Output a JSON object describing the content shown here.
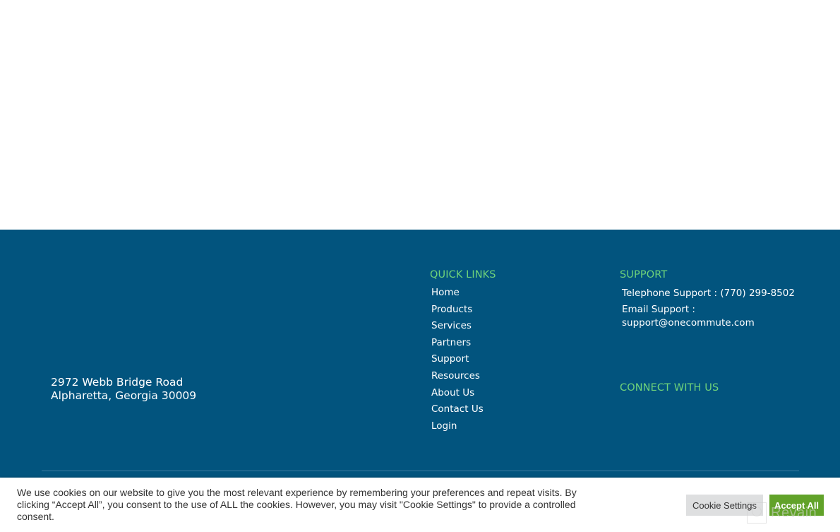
{
  "footer": {
    "address": {
      "line1": "2972 Webb Bridge Road",
      "line2": "Alpharetta, Georgia 30009"
    },
    "quick_links": {
      "heading": "QUICK LINKS",
      "items": [
        {
          "label": "Home"
        },
        {
          "label": "Products"
        },
        {
          "label": "Services"
        },
        {
          "label": "Partners"
        },
        {
          "label": "Support"
        },
        {
          "label": "Resources"
        },
        {
          "label": "About Us"
        },
        {
          "label": "Contact Us"
        },
        {
          "label": "Login"
        }
      ]
    },
    "support": {
      "heading": "SUPPORT",
      "telephone": "Telephone Support : (770) 299-8502",
      "email_label": "Email Support :",
      "email": "support@onecommute.com"
    },
    "connect": {
      "heading": "CONNECT WITH US"
    },
    "colors": {
      "background": "#02547e",
      "heading_accent": "#6fd37a"
    }
  },
  "cookie_banner": {
    "text": "We use cookies on our website to give you the most relevant experience by remembering your preferences and repeat visits. By clicking “Accept All”, you consent to the use of ALL the cookies. However, you may visit \"Cookie Settings\" to provide a controlled consent.",
    "settings_label": "Cookie Settings",
    "accept_label": "Accept All",
    "colors": {
      "accept": "#61a229",
      "settings": "#dedfe0"
    }
  },
  "watermark": {
    "text": "Revain"
  }
}
